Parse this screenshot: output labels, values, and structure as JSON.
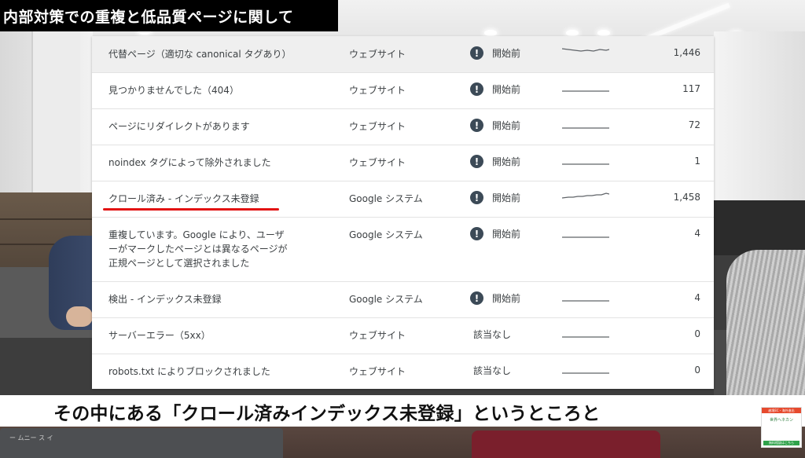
{
  "title_label": "内部対策での重複と低品質ページに関して",
  "table": {
    "rows": [
      {
        "reason": "代替ページ（適切な canonical タグあり）",
        "source": "ウェブサイト",
        "status": "開始前",
        "has_icon": true,
        "count": "1,446"
      },
      {
        "reason": "見つかりませんでした（404）",
        "source": "ウェブサイト",
        "status": "開始前",
        "has_icon": true,
        "count": "117"
      },
      {
        "reason": "ページにリダイレクトがあります",
        "source": "ウェブサイト",
        "status": "開始前",
        "has_icon": true,
        "count": "72"
      },
      {
        "reason": "noindex タグによって除外されました",
        "source": "ウェブサイト",
        "status": "開始前",
        "has_icon": true,
        "count": "1"
      },
      {
        "reason": "クロール済み - インデックス未登録",
        "source": "Google システム",
        "status": "開始前",
        "has_icon": true,
        "count": "1,458"
      },
      {
        "reason_lines": [
          "重複しています。Google により、ユーザ",
          "ーがマークしたページとは異なるページが",
          "正規ページとして選択されました"
        ],
        "source": "Google システム",
        "status": "開始前",
        "has_icon": true,
        "count": "4"
      },
      {
        "reason": "検出 - インデックス未登録",
        "source": "Google システム",
        "status": "開始前",
        "has_icon": true,
        "count": "4"
      },
      {
        "reason": "サーバーエラー（5xx）",
        "source": "ウェブサイト",
        "status": "該当なし",
        "has_icon": false,
        "count": "0"
      },
      {
        "reason": "robots.txt によりブロックされました",
        "source": "ウェブサイト",
        "status": "該当なし",
        "has_icon": false,
        "count": "0"
      }
    ],
    "status_icon": "exclamation-icon"
  },
  "subtitle": "その中にある「クロール済みインデックス未登録」というところと",
  "promo": {
    "top": "越境EC・海外進出",
    "mid": "世界へネカン",
    "bottom": "無料相談はこちら"
  },
  "background": {
    "laptop_label": "ー ムニー ス イ"
  },
  "colors": {
    "status_icon_bg": "#3c4a57",
    "underline": "#e21313",
    "title_bg": "#000000"
  }
}
